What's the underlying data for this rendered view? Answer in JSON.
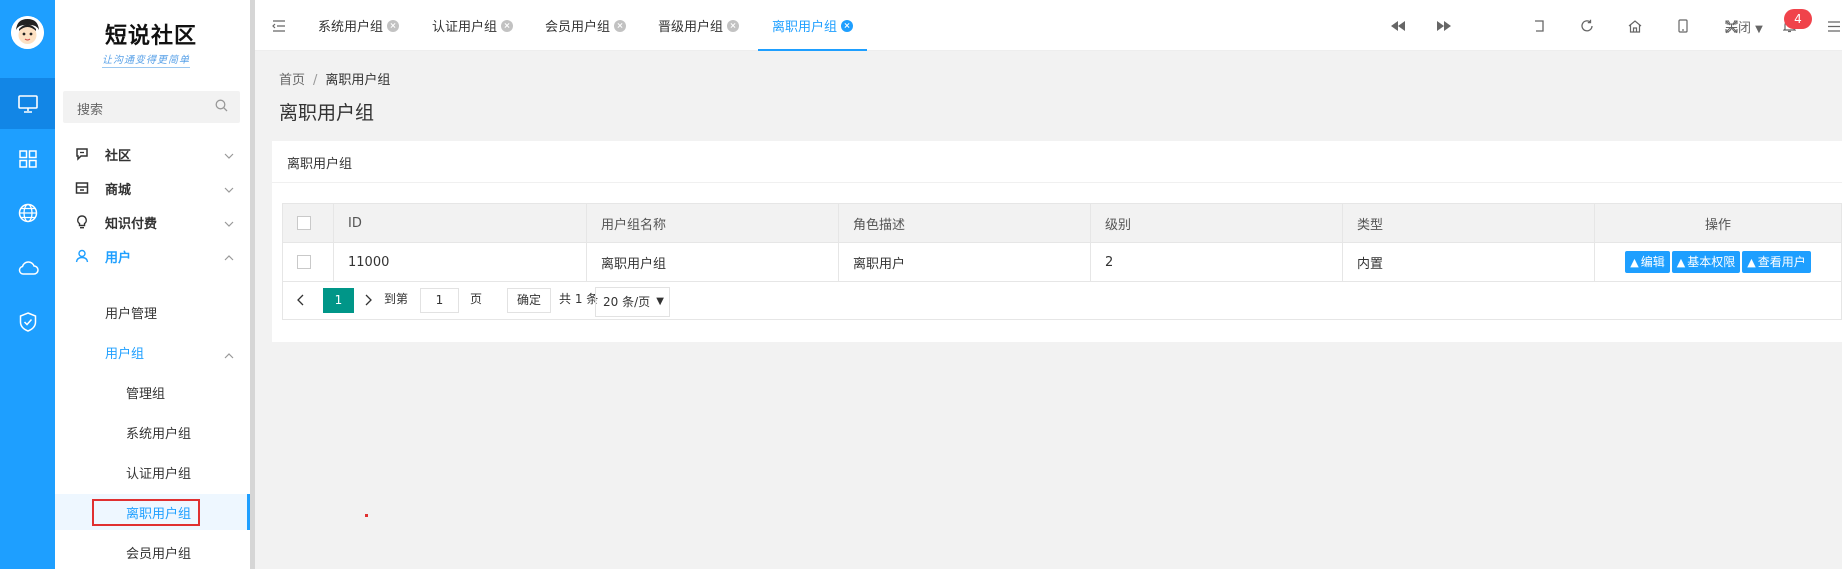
{
  "app": {
    "logo_title": "短说社区",
    "logo_subtitle": "让沟通变得更简单",
    "notification_count": "4"
  },
  "rail": {
    "icons": [
      "monitor-icon",
      "grid-icon",
      "globe-icon",
      "cloud-icon",
      "shield-check-icon"
    ]
  },
  "sidebar": {
    "search_placeholder": "搜索",
    "menu": [
      {
        "label": "社区",
        "icon": "chat-icon",
        "expanded": false
      },
      {
        "label": "商城",
        "icon": "store-icon",
        "expanded": false
      },
      {
        "label": "知识付费",
        "icon": "bulb-icon",
        "expanded": false
      },
      {
        "label": "用户",
        "icon": "user-icon",
        "expanded": true
      }
    ],
    "user_sub": {
      "manage": "用户管理",
      "group": "用户组"
    },
    "groups": [
      "管理组",
      "系统用户组",
      "认证用户组",
      "离职用户组",
      "会员用户组"
    ],
    "active_group": "离职用户组"
  },
  "tabs": [
    {
      "label": "系统用户组",
      "active": false
    },
    {
      "label": "认证用户组",
      "active": false
    },
    {
      "label": "会员用户组",
      "active": false
    },
    {
      "label": "晋级用户组",
      "active": false
    },
    {
      "label": "离职用户组",
      "active": true
    }
  ],
  "toolbar": {
    "close_label": "关闭"
  },
  "breadcrumb": {
    "home": "首页",
    "separator": "/",
    "current": "离职用户组"
  },
  "page": {
    "title": "离职用户组",
    "card_title": "离职用户组"
  },
  "table": {
    "headers": [
      "ID",
      "用户组名称",
      "角色描述",
      "级别",
      "类型",
      "操作"
    ],
    "rows": [
      {
        "id": "11000",
        "name": "离职用户组",
        "desc": "离职用户",
        "level": "2",
        "type": "内置"
      }
    ],
    "actions": [
      "编辑",
      "基本权限",
      "查看用户"
    ]
  },
  "pagination": {
    "current_page": "1",
    "goto_label": "到第",
    "page_input": "1",
    "page_unit": "页",
    "confirm": "确定",
    "total": "共 1 条",
    "page_size": "20 条/页"
  }
}
